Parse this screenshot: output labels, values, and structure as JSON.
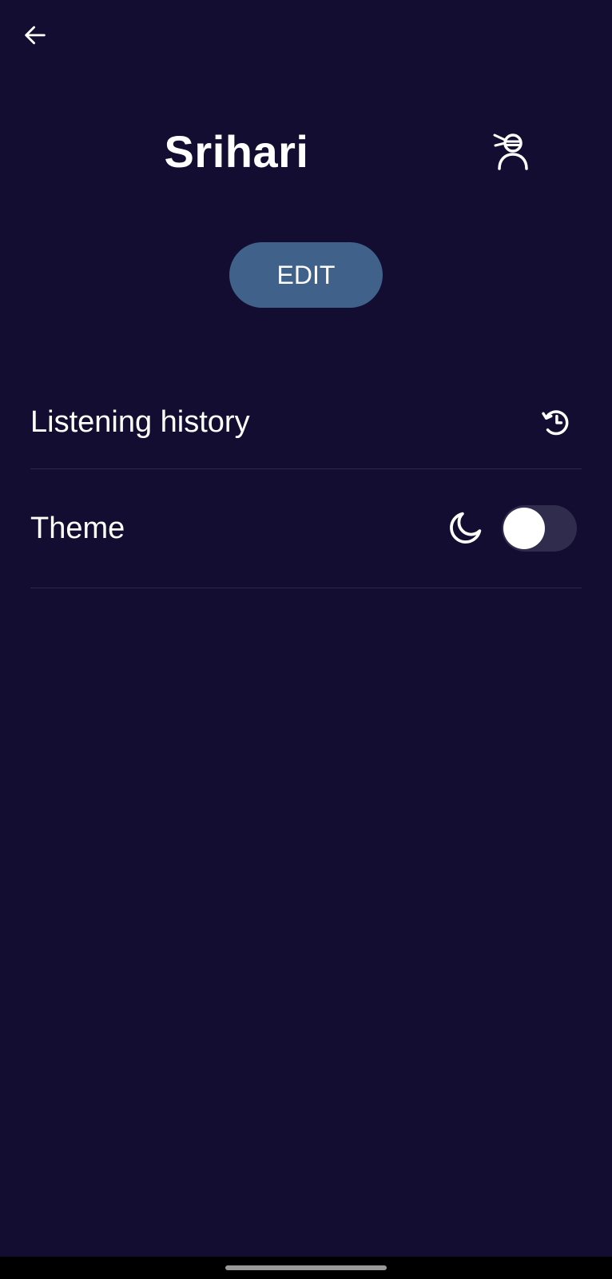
{
  "header": {
    "back_icon": "arrow-left-icon",
    "profile_icon": "ninja-avatar-icon"
  },
  "profile": {
    "name": "Srihari",
    "edit_label": "EDIT"
  },
  "settings": {
    "history": {
      "label": "Listening history",
      "icon": "history-clock-icon"
    },
    "theme": {
      "label": "Theme",
      "icon": "moon-icon",
      "toggle_on": false
    }
  },
  "colors": {
    "background": "#130e31",
    "edit_button": "#40618a",
    "divider": "#2c2850",
    "toggle_track": "#2f2c4d"
  }
}
